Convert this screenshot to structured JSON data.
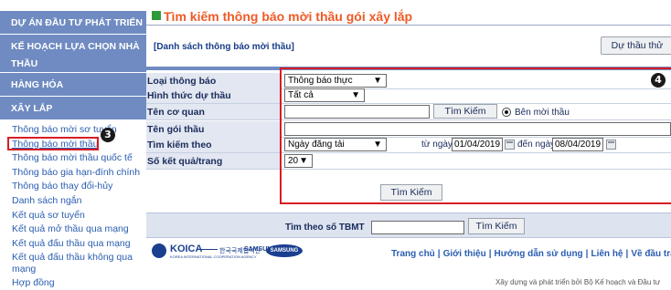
{
  "sidebar": {
    "headers": [
      "DỰ ÁN ĐẦU TƯ PHÁT TRIỂN",
      "KẾ HOẠCH LỰA CHỌN NHÀ THẦU",
      "HÀNG HÓA",
      "XÂY LẮP"
    ],
    "items": [
      {
        "label": "Thông báo mời sơ tuyển"
      },
      {
        "label": "Thông báo mời thầu"
      },
      {
        "label": "Thông báo mời thầu quốc tế"
      },
      {
        "label": "Thông báo gia hạn-đính chính"
      },
      {
        "label": "Thông báo thay đổi-hủy"
      },
      {
        "label": "Danh sách ngắn"
      },
      {
        "label": "Kết quả sơ tuyển"
      },
      {
        "label": "Kết quả mở thầu qua mạng"
      },
      {
        "label": "Kết quả đấu thầu qua mạng"
      },
      {
        "label": "Kết quả đấu thầu không qua mạng"
      },
      {
        "label": "Hợp đồng"
      }
    ],
    "active_item": "Thông báo mời thầu"
  },
  "annotations": {
    "badge_sidebar": "3",
    "badge_filter": "4"
  },
  "main": {
    "title": "Tìm kiếm thông báo mời thầu gói xây lắp",
    "list_link": "[Danh sách thông báo mời thầu]",
    "dry_button": "Dự thầu thử"
  },
  "filter": {
    "notice_type": {
      "label": "Loại thông báo",
      "value": "Thông báo thực"
    },
    "bid_form": {
      "label": "Hình thức dự thầu",
      "value": "Tất cả"
    },
    "agency": {
      "label": "Tên cơ quan",
      "value": "",
      "search_button": "Tìm Kiếm",
      "radio_label": "Bên mời thầu"
    },
    "package": {
      "label": "Tên gói thầu",
      "value": ""
    },
    "search_by": {
      "label": "Tìm kiếm theo",
      "value": "Ngày đăng tải",
      "from_label": "từ ngày",
      "from_value": "01/04/2019",
      "to_label": "đến ngày",
      "to_value": "08/04/2019"
    },
    "per_page": {
      "label": "Số kết quả/trang",
      "value": "20"
    },
    "search_button": "Tìm Kiếm"
  },
  "tbmt": {
    "label": "Tìm theo số TBMT",
    "value": "",
    "button": "Tìm Kiếm"
  },
  "footer": {
    "logos": {
      "koica": "KOICA",
      "koica_sub": "KOREA INTERNATIONAL COOPERATION AGENCY",
      "korean": "한국국제협력단",
      "sds": "SAMSUNG SDS",
      "samsung": "SAMSUNG"
    },
    "nav": [
      "Trang chủ",
      "Giới thiệu",
      "Hướng dẫn sử dụng",
      "Liên hệ",
      "Về đầu trang"
    ],
    "credit": "Xây dựng và phát triển bởi Bộ Kế hoạch và Đầu tư"
  },
  "colors": {
    "accent": "#ee5a26",
    "sidebar_header": "#6f8bc1",
    "highlight": "#d71d26",
    "link": "#2a5db0"
  }
}
